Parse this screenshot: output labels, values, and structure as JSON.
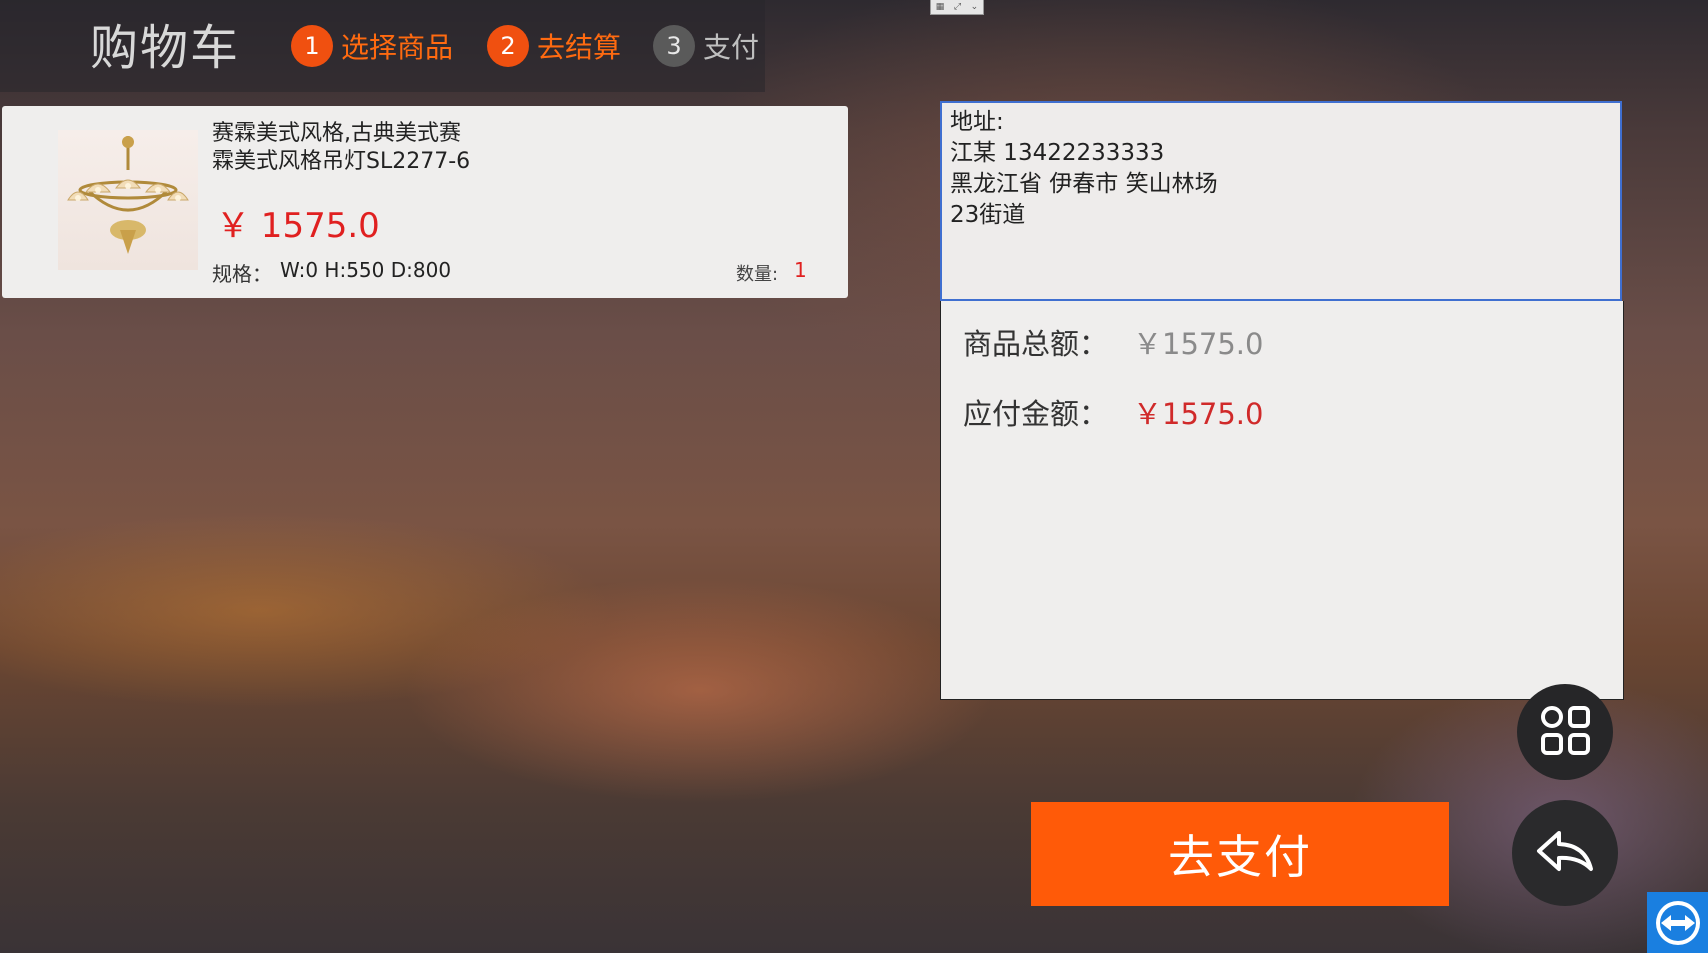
{
  "header": {
    "title": "购物车",
    "steps": [
      {
        "num": "1",
        "label": "选择商品"
      },
      {
        "num": "2",
        "label": "去结算"
      },
      {
        "num": "3",
        "label": "支付"
      }
    ]
  },
  "product": {
    "name_line1": "赛霖美式风格,古典美式赛",
    "name_line2": "霖美式风格吊灯SL2277-6",
    "price": "￥ 1575.0",
    "spec_label": "规格：",
    "spec_value": "W:0 H:550 D:800",
    "qty_label": "数量:",
    "qty_value": "1"
  },
  "address": {
    "label": "地址:",
    "contact": "江某  13422233333",
    "region": "黑龙江省 伊春市 笑山林场",
    "street": "23街道"
  },
  "summary": {
    "total_label": "商品总额：",
    "total_value": "￥1575.0",
    "payable_label": "应付金额：",
    "payable_value": "￥1575.0"
  },
  "actions": {
    "pay_label": "去支付"
  },
  "colors": {
    "accent": "#ff5a08",
    "price_red": "#e02020",
    "step_inactive": "#5a5a5a"
  },
  "icons": [
    "grid-apps-icon",
    "back-arrow-icon",
    "teamviewer-icon",
    "window-toolbar-icon"
  ]
}
